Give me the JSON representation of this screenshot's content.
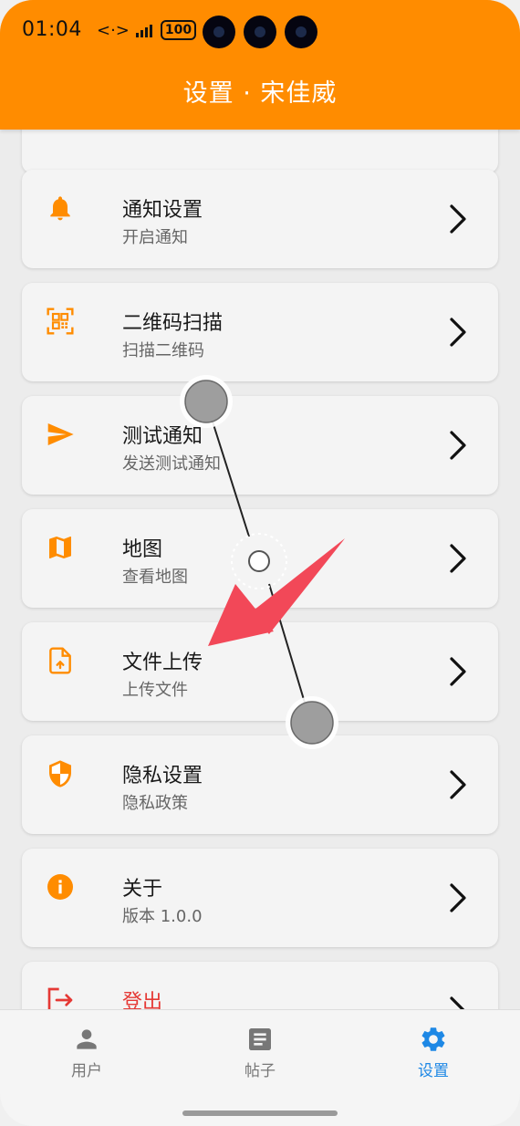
{
  "status_bar": {
    "time": "01:04",
    "network_glyph": "<·>",
    "battery_level": "100"
  },
  "header": {
    "title": "设置 · 宋佳威"
  },
  "settings_items": [
    {
      "title": "通知设置",
      "subtitle": "开启通知",
      "icon": "bell-icon"
    },
    {
      "title": "二维码扫描",
      "subtitle": "扫描二维码",
      "icon": "qr-scan-icon"
    },
    {
      "title": "测试通知",
      "subtitle": "发送测试通知",
      "icon": "send-icon"
    },
    {
      "title": "地图",
      "subtitle": "查看地图",
      "icon": "map-icon"
    },
    {
      "title": "文件上传",
      "subtitle": "上传文件",
      "icon": "file-upload-icon"
    },
    {
      "title": "隐私设置",
      "subtitle": "隐私政策",
      "icon": "shield-icon"
    },
    {
      "title": "关于",
      "subtitle": "版本 1.0.0",
      "icon": "info-icon"
    },
    {
      "title": "登出",
      "subtitle": "",
      "icon": "logout-icon"
    }
  ],
  "bottom_nav": [
    {
      "label": "用户",
      "icon": "person-icon",
      "active": false
    },
    {
      "label": "帖子",
      "icon": "article-icon",
      "active": false
    },
    {
      "label": "设置",
      "icon": "gear-icon",
      "active": true
    }
  ],
  "colors": {
    "accent": "#ff8c00",
    "active_nav": "#1e88e5",
    "danger": "#e53935",
    "annotation_arrow": "#f24858"
  }
}
